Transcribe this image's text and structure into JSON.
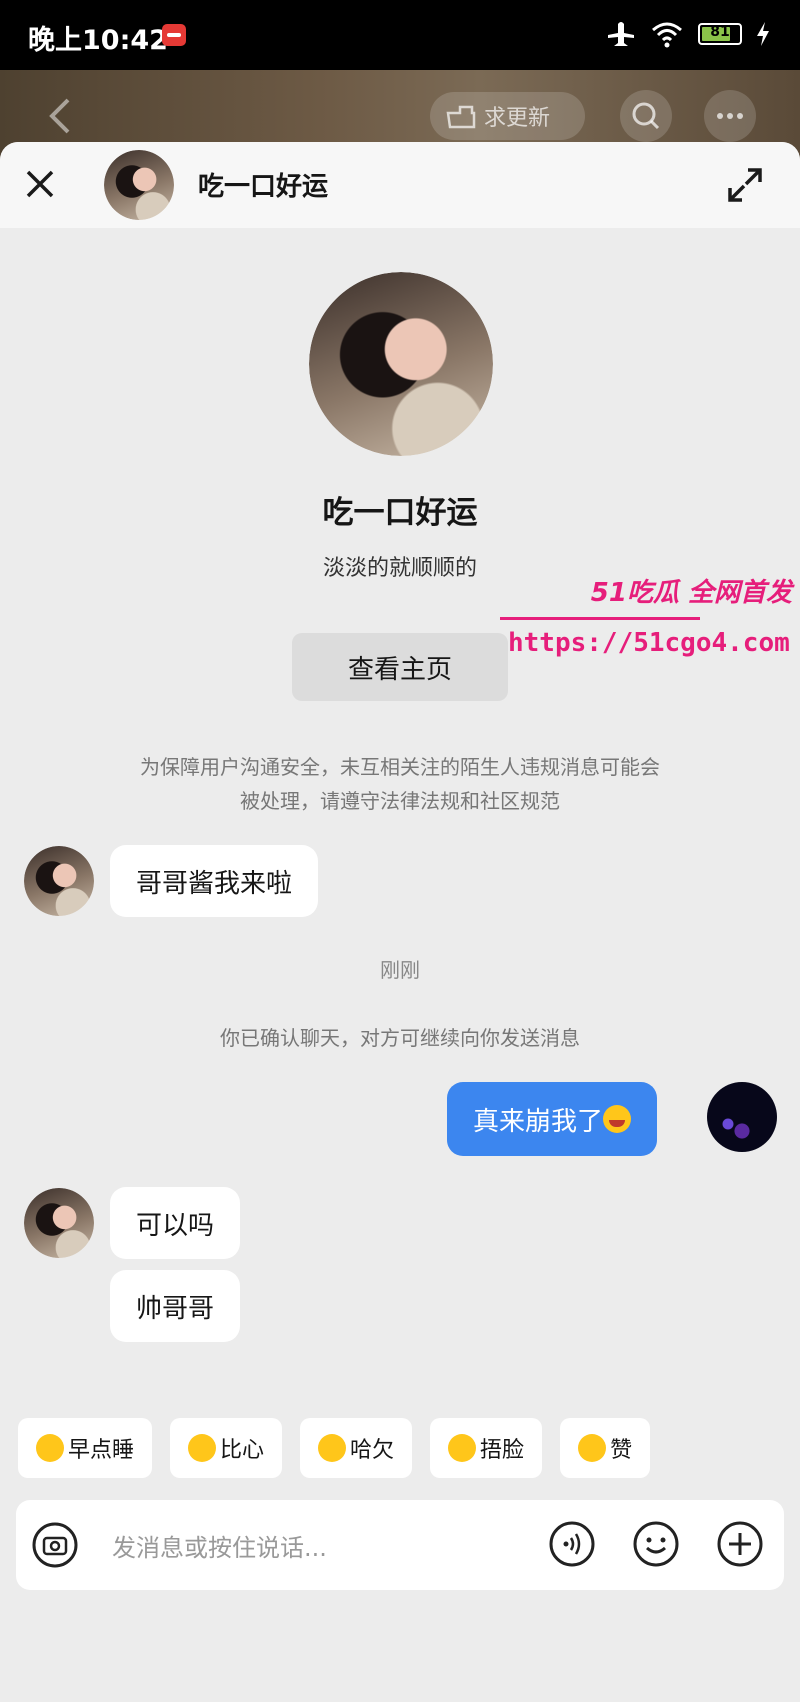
{
  "status_bar": {
    "time": "晚上10:42",
    "battery": "81"
  },
  "bg_header": {
    "update_label": "求更新"
  },
  "top_bar": {
    "name": "吃一口好运"
  },
  "profile": {
    "name": "吃一口好运",
    "bio": "淡淡的就顺顺的",
    "homepage_button": "查看主页"
  },
  "notice": {
    "line1": "为保障用户沟通安全，未互相关注的陌生人违规消息可能会",
    "line2": "被处理，请遵守法律法规和社区规范"
  },
  "messages": {
    "m1": "哥哥酱我来啦",
    "time": "刚刚",
    "confirm": "你已确认聊天，对方可继续向你发送消息",
    "mine": "真来崩我了",
    "m2": "可以吗",
    "m3": "帅哥哥"
  },
  "watermark": {
    "top": "51吃瓜 全网首发",
    "url": "https://51cgo4.com"
  },
  "quick_replies": [
    "早点睡",
    "比心",
    "哈欠",
    "捂脸",
    "赞"
  ],
  "input": {
    "placeholder": "发消息或按住说话..."
  },
  "colors": {
    "accent": "#3c86ef",
    "watermark": "#e61e7b"
  }
}
